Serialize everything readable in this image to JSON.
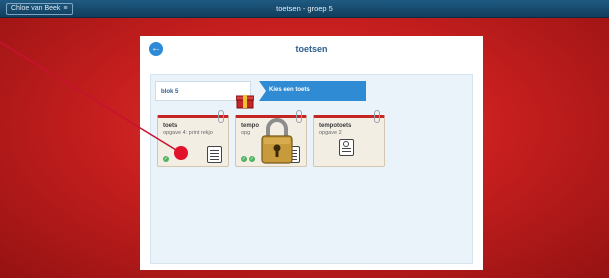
{
  "topbar": {
    "user_label": "Chloe van Beek",
    "menu_glyph": "≡",
    "title": "toetsen - groep 5"
  },
  "panel": {
    "back_glyph": "←",
    "title": "toetsen"
  },
  "breadcrumb": {
    "level1": "blok 5",
    "level2": "Kies een toets"
  },
  "cards": [
    {
      "title": "toets",
      "subtitle": "opgave 4: print rekjo",
      "checks": 1,
      "locked": false
    },
    {
      "title": "tempo",
      "subtitle": "opg",
      "checks": 2,
      "locked": true
    },
    {
      "title": "tempotoets",
      "subtitle": "opgave 2",
      "checks": 0,
      "locked": false
    }
  ],
  "icons": {
    "menu": "menu-icon",
    "back": "back-arrow-icon",
    "box": "box-icon",
    "lock": "lock-icon",
    "doc": "worksheet-icon",
    "check": "check-icon"
  },
  "colors": {
    "background": "#c81f1f",
    "topbar": "#1e5a82",
    "accent": "#2f8bd3",
    "pointer": "#c81230"
  }
}
